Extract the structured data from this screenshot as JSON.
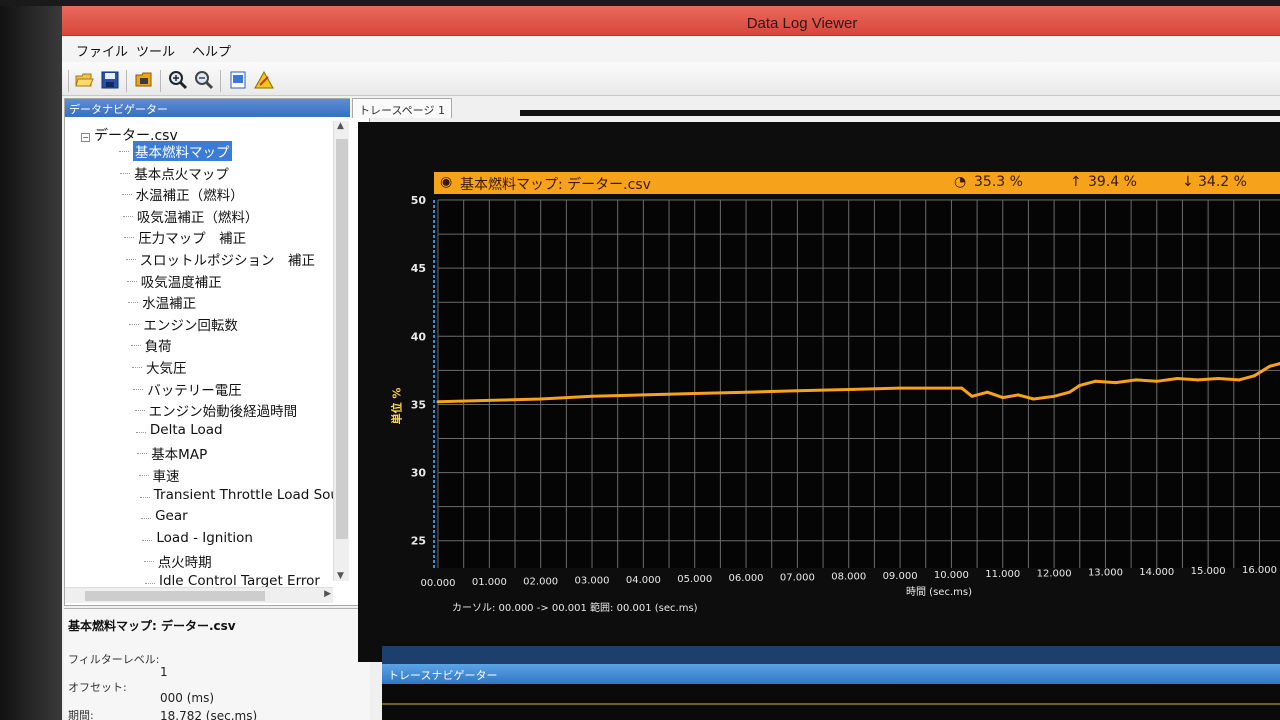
{
  "window": {
    "title": "Data Log Viewer"
  },
  "menu": [
    "ファイル",
    "ツール",
    "ヘルプ"
  ],
  "toolbar": {
    "buttons": [
      "open-icon",
      "save-icon",
      "open-folder-icon",
      "zoom-in-icon",
      "zoom-out-icon",
      "export-icon",
      "warning-icon"
    ]
  },
  "navigator": {
    "title": "データナビゲーター",
    "root": "データー.csv",
    "items": [
      "基本燃料マップ",
      "基本点火マップ",
      "水温補正（燃料）",
      "吸気温補正（燃料）",
      "圧力マップ　補正",
      "スロットルポジション　補正",
      "吸気温度補正",
      "水温補正",
      "エンジン回転数",
      "負荷",
      "大気圧",
      "バッテリー電圧",
      "エンジン始動後経過時間",
      "Delta Load",
      "基本MAP",
      "車速",
      "Transient Throttle Load Sou",
      "Gear",
      "Load - Ignition",
      "点火時期",
      "Idle Control Target Error"
    ],
    "selected_index": 0
  },
  "properties": {
    "title": "基本燃料マップ: データー.csv",
    "filter_label": "フィルターレベル:",
    "filter_value": "1",
    "offset_label": "オフセット:",
    "offset_value": "000 (ms)",
    "period_label": "期間:",
    "period_value": "18.782 (sec.ms)"
  },
  "tab": {
    "label": "トレースページ 1"
  },
  "trace": {
    "header_label": "基本燃料マップ: データー.csv",
    "avg": "35.3 %",
    "max": "39.4 %",
    "min": "34.2 %",
    "color": "#f7a21b",
    "ylabel": "単位 %",
    "xlabel": "時間 (sec.ms)",
    "cursor_text": "カーソル: 00.000 -> 00.001 範囲: 00.001 (sec.ms)"
  },
  "trace_navigator": {
    "title": "トレースナビゲーター"
  },
  "chart_data": {
    "type": "line",
    "xlabel": "時間 (sec.ms)",
    "ylabel": "単位 %",
    "x_ticks": [
      "00.000",
      "01.000",
      "02.000",
      "03.000",
      "04.000",
      "05.000",
      "06.000",
      "07.000",
      "08.000",
      "09.000",
      "10.000",
      "11.000",
      "12.000",
      "13.000",
      "14.000",
      "15.000",
      "16.000"
    ],
    "y_ticks": [
      25,
      30,
      35,
      40,
      45,
      50
    ],
    "ylim": [
      23,
      50
    ],
    "xlim": [
      0,
      16.4
    ],
    "grid": true,
    "series": [
      {
        "color": "#f7a21b",
        "x": [
          0,
          1,
          2,
          3,
          4,
          5,
          6,
          7,
          8,
          9,
          10.2,
          10.4,
          10.7,
          11.0,
          11.3,
          11.6,
          12.0,
          12.3,
          12.5,
          12.8,
          13.2,
          13.6,
          14.0,
          14.4,
          14.8,
          15.2,
          15.6,
          15.9,
          16.2,
          16.4
        ],
        "y": [
          35.2,
          35.3,
          35.4,
          35.6,
          35.7,
          35.8,
          35.9,
          36.0,
          36.1,
          36.2,
          36.2,
          35.6,
          35.9,
          35.5,
          35.7,
          35.4,
          35.6,
          35.9,
          36.4,
          36.7,
          36.6,
          36.8,
          36.7,
          36.9,
          36.8,
          36.9,
          36.8,
          37.1,
          37.8,
          38.0
        ]
      }
    ]
  }
}
